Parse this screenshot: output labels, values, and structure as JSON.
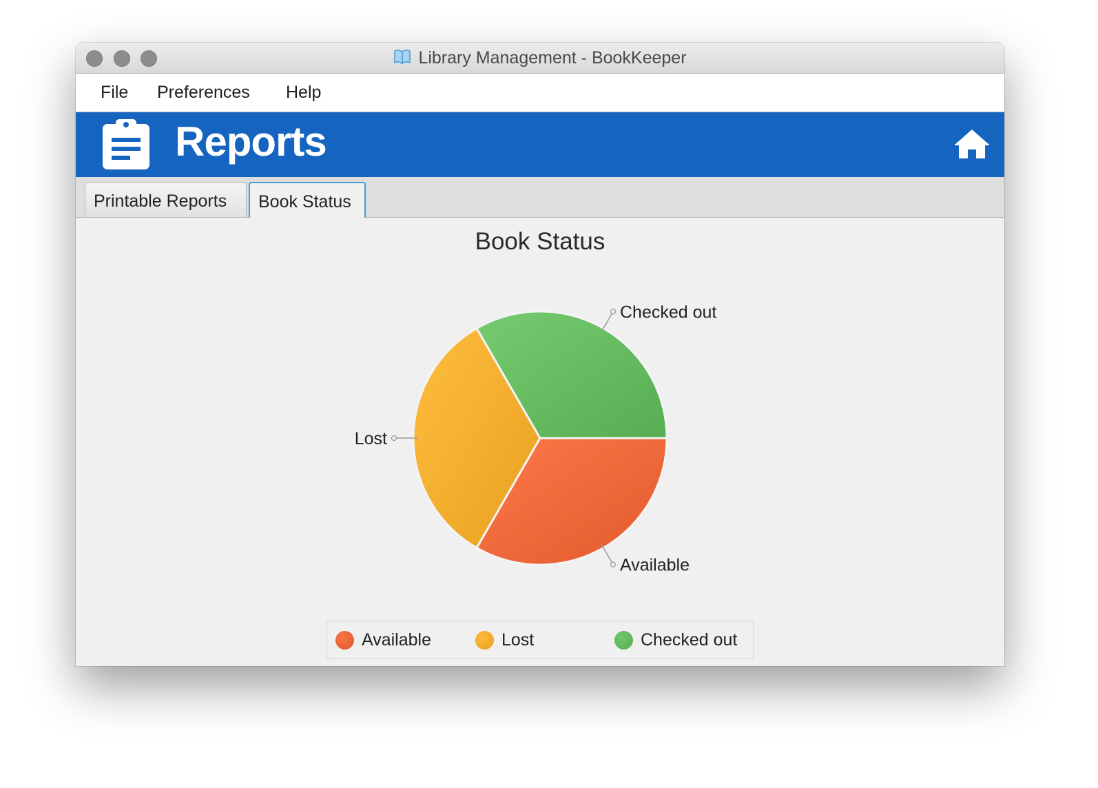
{
  "window": {
    "title": "Library Management - BookKeeper"
  },
  "menu": {
    "file": "File",
    "preferences": "Preferences",
    "help": "Help"
  },
  "banner": {
    "title": "Reports",
    "color": "#1565c0"
  },
  "tabs": [
    {
      "label": "Printable Reports",
      "active": false
    },
    {
      "label": "Book Status",
      "active": true
    }
  ],
  "icons": {
    "app": "open-book-icon",
    "banner": "clipboard-list-icon",
    "home": "home-icon"
  },
  "chart_data": {
    "type": "pie",
    "title": "Book Status",
    "categories": [
      "Available",
      "Lost",
      "Checked out"
    ],
    "values": [
      1,
      1,
      1
    ],
    "colors": [
      "#e05a2b",
      "#e8a020",
      "#58ad52"
    ],
    "legend_position": "bottom"
  }
}
